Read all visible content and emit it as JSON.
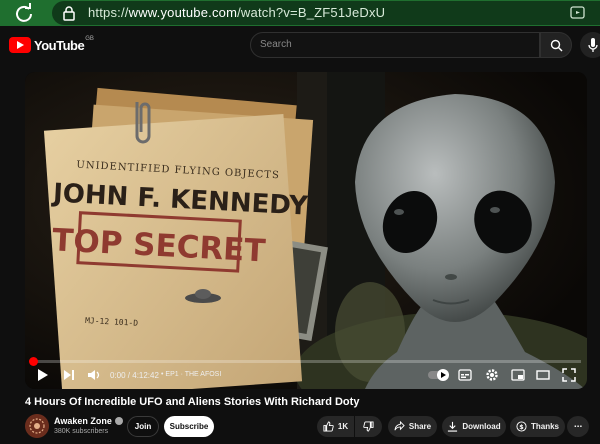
{
  "browser": {
    "url_prefix": "https://",
    "url_host": "www.youtube.com",
    "url_path": "/watch?v=B_ZF51JeDxU"
  },
  "header": {
    "logo_text": "YouTube",
    "region": "GB",
    "search_placeholder": "Search"
  },
  "player": {
    "time": "0:00 / 4:12:42",
    "chapter": "• EP1 · THE AFOSI",
    "progress_fraction": 0.0,
    "thumbnail": {
      "line1": "UNIDENTIFIED FLYING OBJECTS",
      "line2": "JOHN F. KENNEDY",
      "stamp": "TOP SECRET",
      "code": "MJ-12 101-D"
    }
  },
  "video": {
    "title": "4 Hours Of Incredible UFO and Aliens Stories With Richard Doty"
  },
  "channel": {
    "name": "Awaken Zone",
    "subscribers": "380K subscribers",
    "join_label": "Join",
    "subscribe_label": "Subscribe"
  },
  "actions": {
    "likes": "1K",
    "share": "Share",
    "download": "Download",
    "thanks": "Thanks",
    "more": "⋯"
  },
  "colors": {
    "browser_bar": "#1f6f2f",
    "accent_red": "#ff0000",
    "page_bg": "#0f0f0f"
  }
}
